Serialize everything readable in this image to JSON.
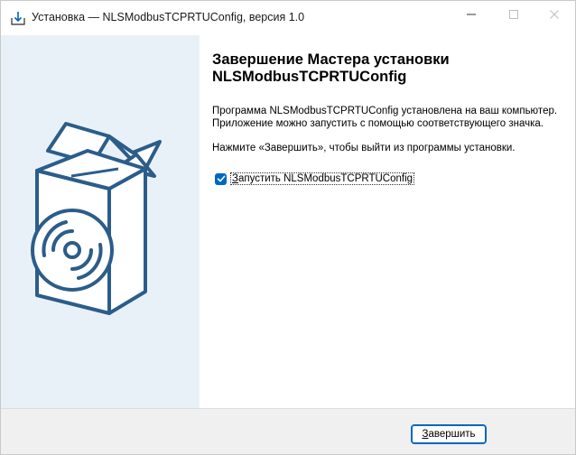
{
  "window": {
    "title": "Установка — NLSModbusTCPRTUConfig, версия 1.0",
    "icon": "installer-icon"
  },
  "titlebar_buttons": {
    "minimize": "minimize-icon",
    "maximize": "maximize-icon",
    "close": "close-icon"
  },
  "content": {
    "heading": "Завершение Мастера установки NLSModbusTCPRTUConfig",
    "para1_line1": "Программа NLSModbusTCPRTUConfig установлена на ваш компьютер.",
    "para1_line2": "Приложение можно запустить с помощью соответствующего значка.",
    "para2": "Нажмите «Завершить», чтобы выйти из программы установки.",
    "checkbox_label": "Запустить NLSModbusTCPRTUConfig",
    "checkbox_checked": true
  },
  "footer": {
    "finish_label": "Завершить"
  },
  "colors": {
    "accent": "#0067c0",
    "sidebar_bg": "#e9f1f8",
    "footer_bg": "#f0f0f0"
  }
}
